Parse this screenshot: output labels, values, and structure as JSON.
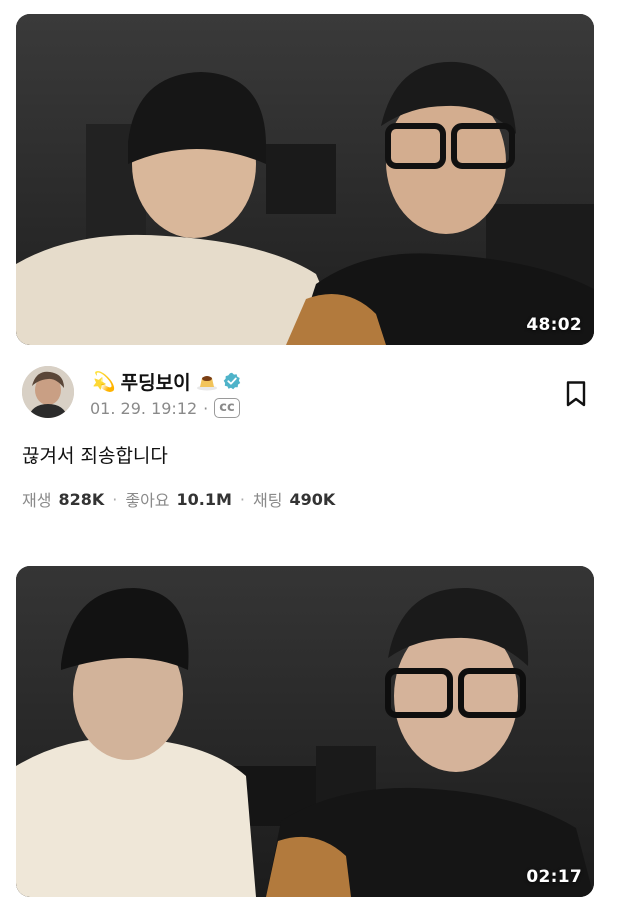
{
  "videos": [
    {
      "duration": "48:02"
    },
    {
      "duration": "02:17"
    }
  ],
  "post": {
    "channel_name": "푸딩보이",
    "channel_emoji_prefix": "💫",
    "date": "01. 29. 19:12",
    "date_sep": "·",
    "cc_label": "cc",
    "title": "끊겨서 죄송합니다",
    "stats": {
      "views_label": "재생",
      "views": "828K",
      "likes_label": "좋아요",
      "likes": "10.1M",
      "chats_label": "채팅",
      "chats": "490K",
      "sep": "·"
    }
  },
  "colors": {
    "verified": "#4fb3c9",
    "muted_text": "#8a8a8a",
    "thumb_bg": "#2b2b2b"
  },
  "icons": {
    "bookmark": "bookmark-icon",
    "verified": "verified-badge-icon",
    "pudding": "pudding-emoji-icon"
  }
}
